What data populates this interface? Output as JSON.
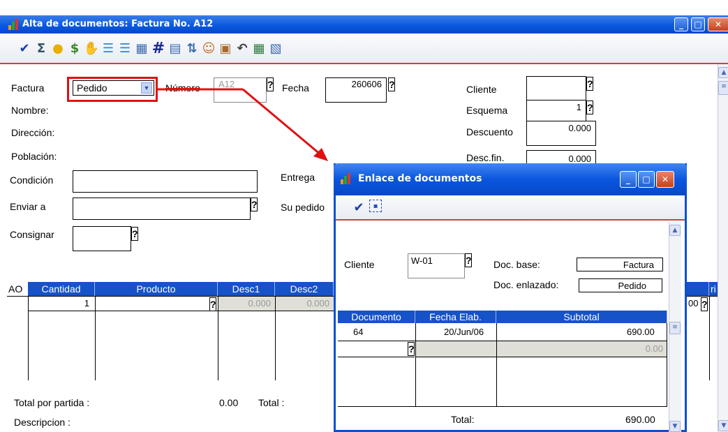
{
  "window": {
    "title": "Alta de documentos: Factura No. A12"
  },
  "form": {
    "factura_label": "Factura",
    "factura_value": "Pedido",
    "numero_label": "Número",
    "numero_value": "A12",
    "fecha_label": "Fecha",
    "fecha_value": "260606",
    "cliente_label": "Cliente",
    "cliente_value": "",
    "esquema_label": "Esquema",
    "esquema_value": "1",
    "descuento_label": "Descuento",
    "descuento_value": "0.000",
    "descfin_label": "Desc.fin.",
    "descfin_value": "0.000",
    "nombre_label": "Nombre:",
    "direccion_label": "Dirección:",
    "poblacion_label": "Población:",
    "condicion_label": "Condición",
    "entrega_label": "Entrega",
    "enviar_label": "Enviar a",
    "supedido_label": "Su pedido",
    "consignar_label": "Consignar"
  },
  "grid": {
    "headers": [
      "AO",
      "Cantidad",
      "Producto",
      "Desc1",
      "Desc2"
    ],
    "row": {
      "cantidad": "1",
      "desc1": "0.000",
      "desc2": "0.000"
    },
    "right_partial_value": "00",
    "right_partial_header": "ri"
  },
  "footer": {
    "total_partida_label": "Total por partida :",
    "total_partida_value": "0.00",
    "total_label": "Total :",
    "descripcion_label": "Descripcion :"
  },
  "dialog": {
    "title": "Enlace de documentos",
    "cliente_label": "Cliente",
    "cliente_value": "W-01",
    "docbase_label": "Doc. base:",
    "docbase_value": "Factura",
    "docenlazado_label": "Doc. enlazado:",
    "docenlazado_value": "Pedido",
    "headers": [
      "Documento",
      "Fecha Elab.",
      "Subtotal"
    ],
    "rows": [
      {
        "documento": "64",
        "fecha": "20/Jun/06",
        "subtotal": "690.00"
      },
      {
        "documento": "",
        "fecha": "",
        "subtotal": "0.00"
      }
    ],
    "total_label": "Total:",
    "total_value": "690.00"
  },
  "colors": {
    "titlebar": "#0a5ae0",
    "grid_header": "#1652c8",
    "highlight": "#e01010"
  },
  "question_mark": "?"
}
